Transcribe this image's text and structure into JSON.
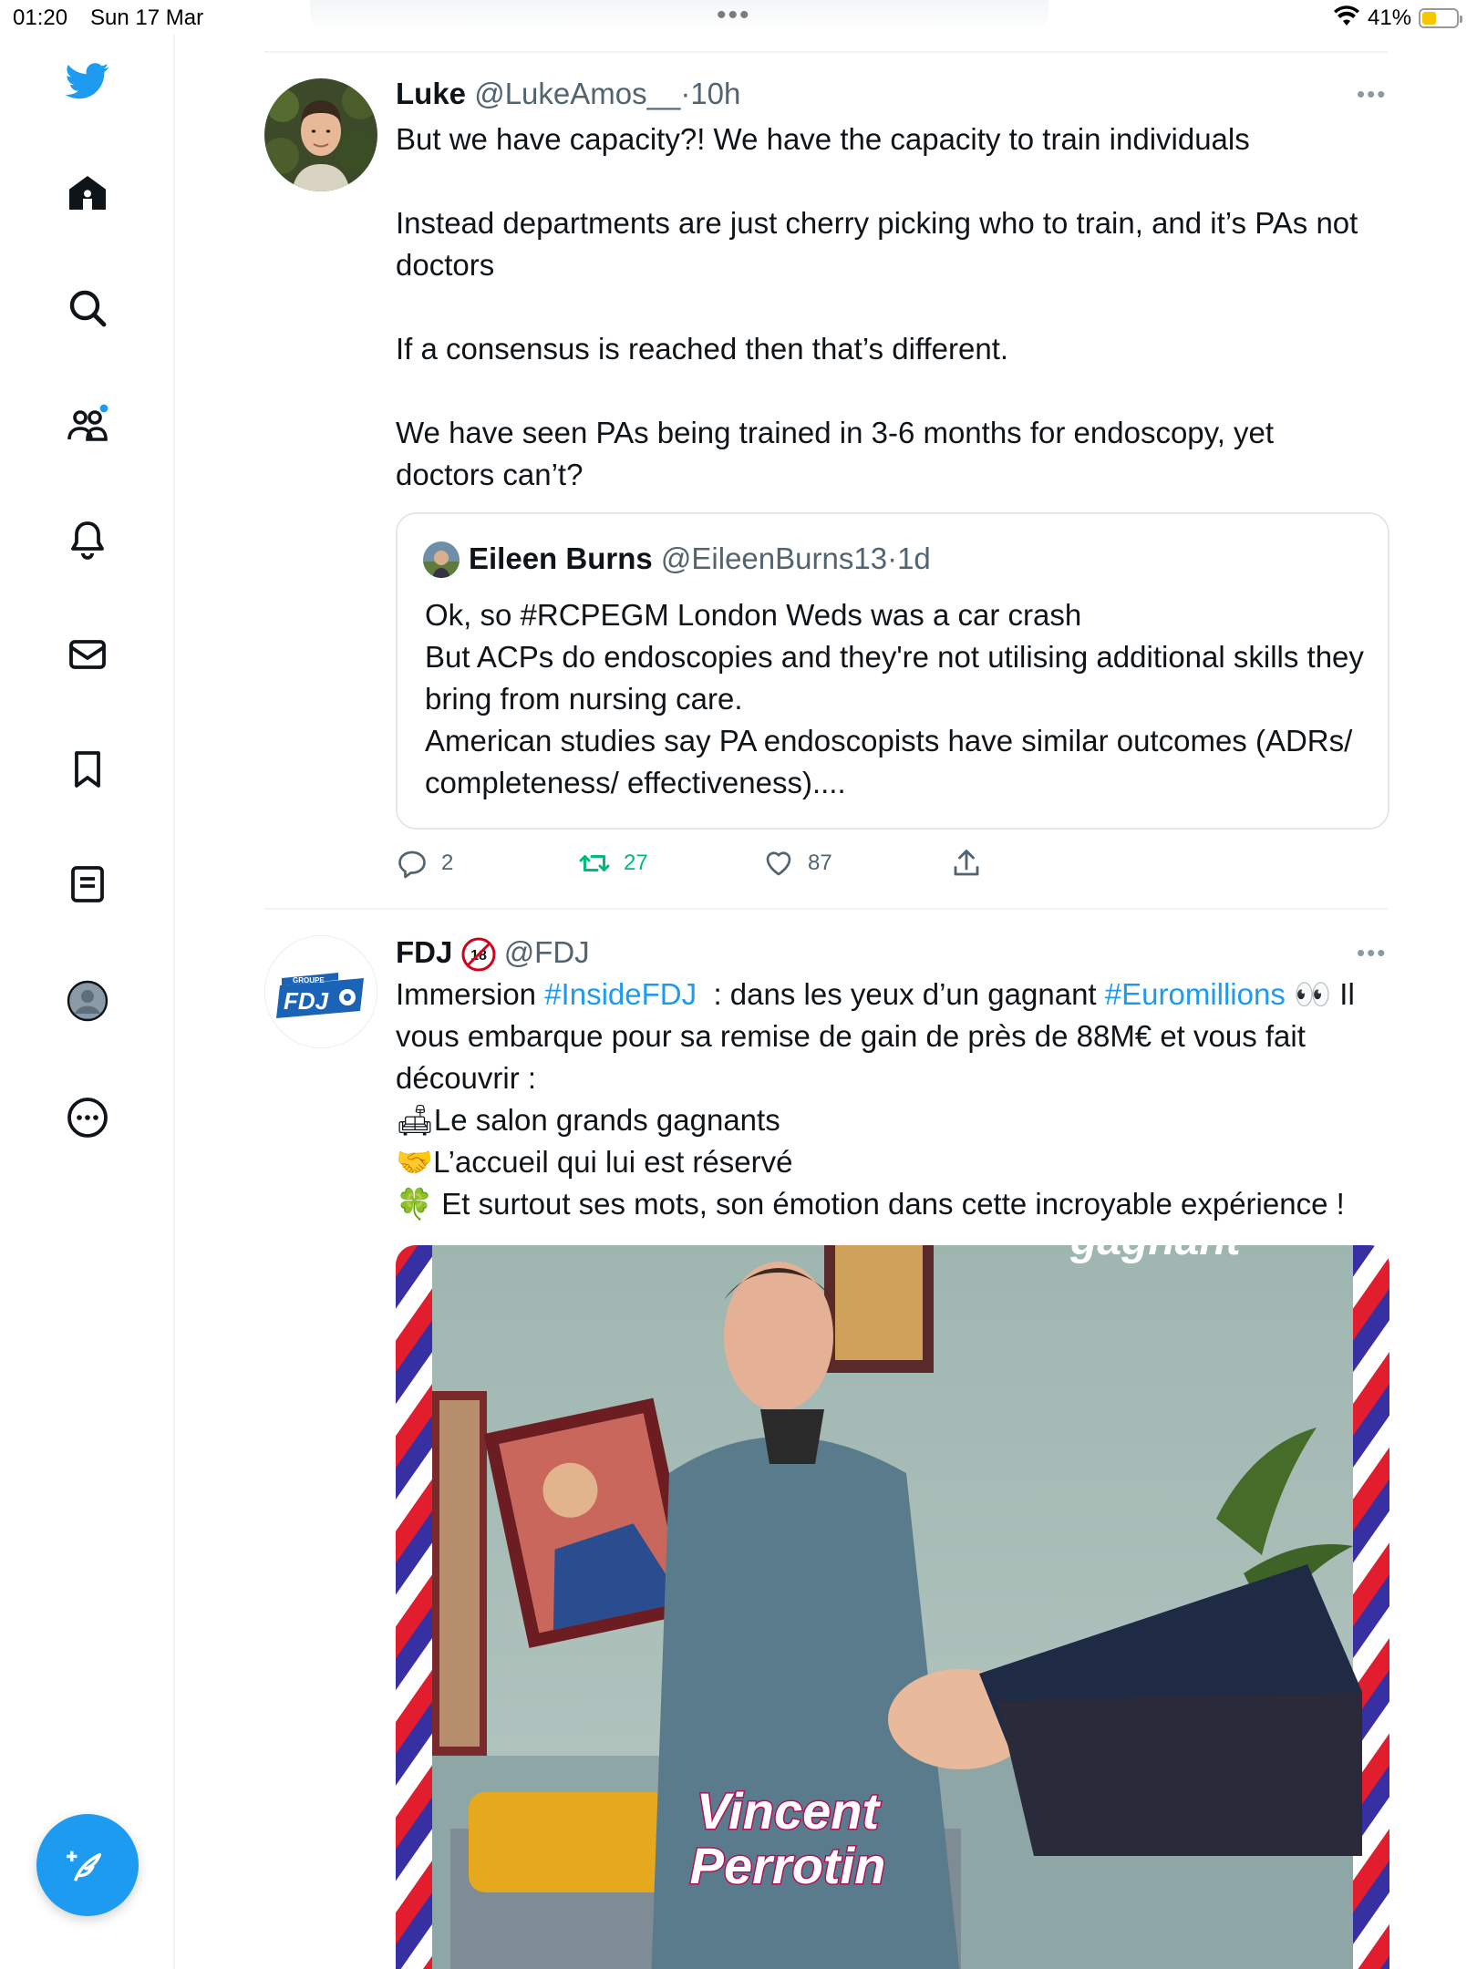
{
  "status_bar": {
    "time": "01:20",
    "date": "Sun 17 Mar",
    "battery": "41%",
    "battery_level": 0.41
  },
  "sidebar": {
    "items": [
      {
        "name": "home",
        "icon": "home-icon"
      },
      {
        "name": "explore",
        "icon": "search-icon"
      },
      {
        "name": "communities",
        "icon": "communities-icon"
      },
      {
        "name": "notifications",
        "icon": "bell-icon"
      },
      {
        "name": "messages",
        "icon": "mail-icon"
      },
      {
        "name": "bookmarks",
        "icon": "bookmark-icon"
      },
      {
        "name": "lists",
        "icon": "list-icon"
      },
      {
        "name": "profile",
        "icon": "profile-icon"
      },
      {
        "name": "more",
        "icon": "more-circle-icon"
      }
    ],
    "compose_icon": "compose-feather-icon",
    "brand_color": "#1d9bf0"
  },
  "tweets": [
    {
      "name": "Luke",
      "handle": "@LukeAmos__",
      "sep": "·",
      "time": "10h",
      "paragraphs": [
        "But we have capacity?! We have the capacity to train individuals",
        "Instead departments are just cherry picking who to train, and it’s PAs not doctors",
        "If a consensus is reached then that’s different.",
        "We have seen PAs being trained in 3-6 months for endoscopy, yet doctors can’t?"
      ],
      "quote": {
        "name": "Eileen Burns",
        "handle": "@EileenBurns13",
        "sep": "·",
        "time": "1d",
        "lines": [
          "Ok, so #RCPEGM London Weds was a car crash",
          "But ACPs do endoscopies and they're not utilising additional skills they bring from nursing care.",
          "American studies say PA endoscopists have similar outcomes (ADRs/ completeness/ effectiveness)...."
        ]
      },
      "actions": {
        "replies": "2",
        "retweets": "27",
        "likes": "87"
      }
    },
    {
      "name": "FDJ",
      "handle": "@FDJ",
      "badge": "18",
      "logo_text": "FDJ",
      "logo_small": "GROUPE",
      "text_parts": {
        "before1": "Immersion ",
        "tag1": "#InsideFDJ",
        "between": "  : dans les yeux d’un gagnant ",
        "tag2": "#Euromillions",
        "after": " 👀 Il vous embarque pour sa remise de gain de près de 88M€ et vous fait découvrir :"
      },
      "list_lines": [
        {
          "emoji": "🛋",
          "text": "Le salon grands gagnants"
        },
        {
          "emoji": "🤝",
          "text": "L’accueil qui lui est réservé"
        },
        {
          "emoji": "🍀",
          "text": " Et surtout ses mots, son émotion dans cette incroyable expérience !"
        }
      ],
      "media": {
        "caption_line1": "Vincent",
        "caption_line2": "Perrotin",
        "top_text": "gagnant"
      }
    }
  ]
}
